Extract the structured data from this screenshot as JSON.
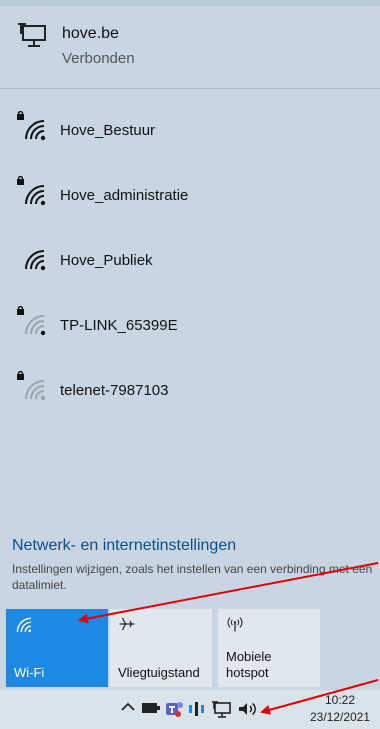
{
  "connected": {
    "name": "hove.be",
    "status": "Verbonden",
    "icon": "ethernet-icon"
  },
  "networks": [
    {
      "name": "Hove_Bestuur",
      "secured": true,
      "icon": "wifi-secured-icon"
    },
    {
      "name": "Hove_administratie",
      "secured": true,
      "icon": "wifi-secured-icon"
    },
    {
      "name": "Hove_Publiek",
      "secured": false,
      "icon": "wifi-icon"
    },
    {
      "name": "TP-LINK_65399E",
      "secured": true,
      "icon": "wifi-weak-secured-icon"
    },
    {
      "name": "telenet-7987103",
      "secured": true,
      "icon": "wifi-weak-secured-icon"
    }
  ],
  "settings": {
    "link": "Netwerk- en internetinstellingen",
    "description": "Instellingen wijzigen, zoals het instellen van een verbinding met een datalimiet."
  },
  "quick_actions": [
    {
      "label": "Wi-Fi",
      "active": true,
      "icon": "wifi-icon"
    },
    {
      "label": "Vliegtuigstand",
      "active": false,
      "icon": "airplane-icon"
    },
    {
      "label": "Mobiele hotspot",
      "active": false,
      "icon": "hotspot-icon"
    }
  ],
  "taskbar": {
    "time": "10:22",
    "date": "23/12/2021",
    "icons": [
      "chevron-up-icon",
      "battery-icon",
      "teams-icon",
      "meet-now-icon",
      "network-icon",
      "volume-icon"
    ]
  },
  "colors": {
    "accent": "#1e88e5",
    "panel": "#c8d6e3",
    "link": "#0b4f86",
    "annotation": "#e00000"
  }
}
